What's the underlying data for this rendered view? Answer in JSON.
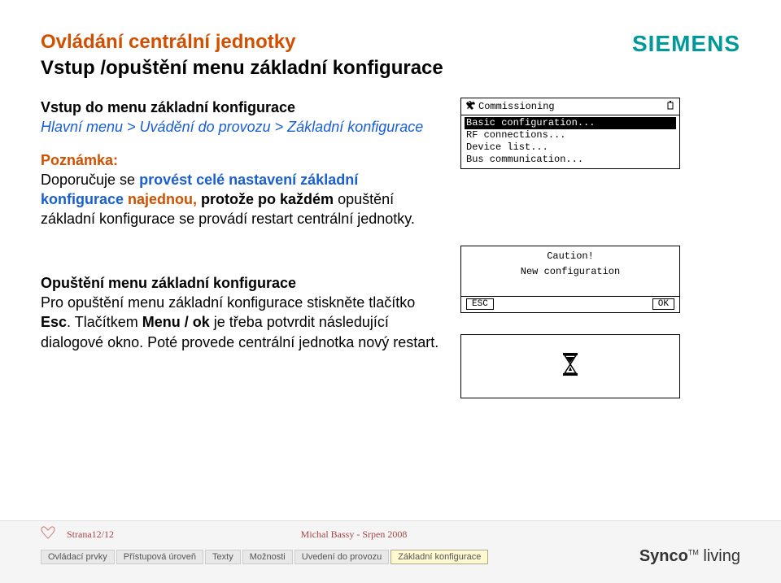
{
  "brand": "SIEMENS",
  "title1": "Ovládání centrální jednotky",
  "title2": "Vstup /opuštění menu základní konfigurace",
  "section1": {
    "heading": "Vstup do menu základní konfigurace",
    "breadcrumb": "Hlavní menu > Uvádění do provozu > Základní konfigurace",
    "note_label": "Poznámka:",
    "note_line_part1": "Doporučuje se ",
    "note_line_part2": "provést celé nastavení základní konfigurace ",
    "note_line_part3": "najednou, ",
    "note_line_part4": "protože po každém opuštění základní konfigurace se provádí restart centrální jednotky."
  },
  "section2": {
    "heading": "Opuštění menu základní konfigurace",
    "body_part1": "Pro opuštění menu základní konfigurace stiskněte tlačítko ",
    "body_bold1": "Esc",
    "body_part2": ". Tlačítkem ",
    "body_bold2": "Menu / ok",
    "body_part3": " je třeba potvrdit následující dialogové okno. Poté provede centrální jednotka nový restart."
  },
  "lcd1": {
    "icon_wrench": "wrench-icon",
    "row1": "Commissioning",
    "battery": "battery-icon",
    "row2": "Basic configuration...",
    "row3": "RF connections...",
    "row4": "Device list...",
    "row5": "Bus communication..."
  },
  "lcd2": {
    "line1": "Caution!",
    "line2": "New configuration",
    "esc": "ESC",
    "ok": "OK"
  },
  "lcd3": {
    "icon": "hourglass-icon"
  },
  "footer": {
    "page": "Strana12/12",
    "author": "Michal Bassy - Srpen 2008",
    "tabs": [
      "Ovládací prvky",
      "Přístupová úroveň",
      "Texty",
      "Možnosti",
      "Uvedení do provozu",
      "Základní konfigurace"
    ],
    "active_tab_index": 5,
    "product": "Synco",
    "product_tm": "TM",
    "product_suffix": "living"
  }
}
